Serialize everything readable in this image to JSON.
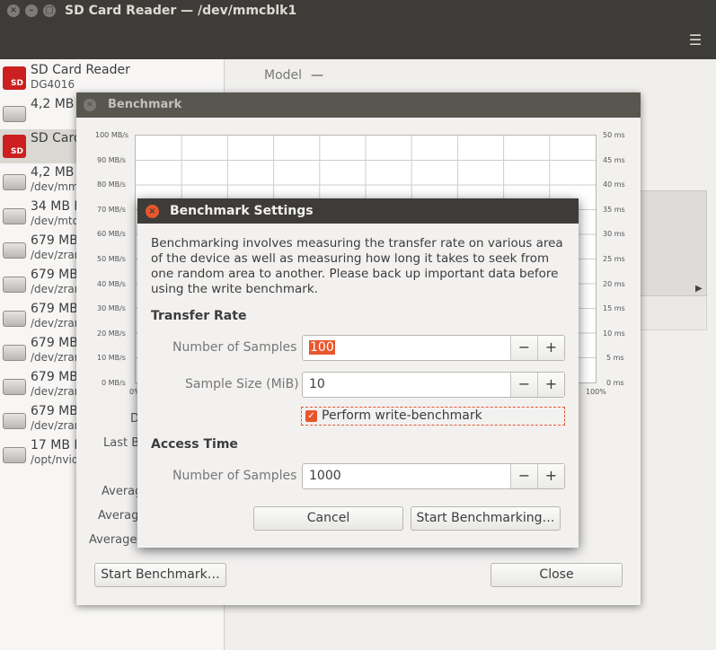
{
  "window": {
    "title": "SD Card Reader — /dev/mmcblk1",
    "menu_icon": "hamburger-menu-icon"
  },
  "sidebar": {
    "items": [
      {
        "line1": "SD Card Reader",
        "line2": "DG4016",
        "icon": "sd-card-icon"
      },
      {
        "line1": "4,2 MB F",
        "line2": "",
        "icon": "drive-icon"
      },
      {
        "line1": "SD Card",
        "line2": "",
        "icon": "sd-card-icon"
      },
      {
        "line1": "4,2 MB F",
        "line2": "/dev/mm",
        "icon": "drive-icon"
      },
      {
        "line1": "34 MB B",
        "line2": "/dev/mto",
        "icon": "drive-icon"
      },
      {
        "line1": "679 MB",
        "line2": "/dev/zrar",
        "icon": "drive-icon"
      },
      {
        "line1": "679 MB",
        "line2": "/dev/zrar",
        "icon": "drive-icon"
      },
      {
        "line1": "679 MB",
        "line2": "/dev/zrar",
        "icon": "drive-icon"
      },
      {
        "line1": "679 MB",
        "line2": "/dev/zrar",
        "icon": "drive-icon"
      },
      {
        "line1": "679 MB",
        "line2": "/dev/zrar",
        "icon": "drive-icon"
      },
      {
        "line1": "679 MB",
        "line2": "/dev/zrar",
        "icon": "drive-icon"
      },
      {
        "line1": "17 MB L",
        "line2": "/opt/nvid",
        "icon": "drive-icon"
      }
    ]
  },
  "main": {
    "model_label": "Model",
    "model_value": "—"
  },
  "benchmark": {
    "title": "Benchmark",
    "y_left_ticks": [
      "100 MB/s",
      "90 MB/s",
      "80 MB/s",
      "70 MB/s",
      "60 MB/s",
      "50 MB/s",
      "40 MB/s",
      "30 MB/s",
      "20 MB/s",
      "10 MB/s",
      "0 MB/s"
    ],
    "y_right_ticks": [
      "50 ms",
      "45 ms",
      "40 ms",
      "35 ms",
      "30 ms",
      "25 ms",
      "20 ms",
      "15 ms",
      "10 ms",
      "5 ms",
      "0 ms"
    ],
    "x_start": "0%",
    "x_end": "100%",
    "side_labels": [
      "D",
      "Last B",
      "Averag",
      "Averag",
      "Average"
    ],
    "start_button": "Start Benchmark…",
    "close_button": "Close"
  },
  "settings": {
    "title": "Benchmark Settings",
    "description": "Benchmarking involves measuring the transfer rate on various area of the device as well as measuring how long it takes to seek from one random area to another. Please back up important data before using the write benchmark.",
    "transfer_rate": {
      "heading": "Transfer Rate",
      "num_samples_label": "Number of Samples",
      "num_samples_value": "100",
      "sample_size_label": "Sample Size (MiB)",
      "sample_size_value": "10",
      "write_benchmark_label": "Perform write-benchmark",
      "write_benchmark_checked": true
    },
    "access_time": {
      "heading": "Access Time",
      "num_samples_label": "Number of Samples",
      "num_samples_value": "1000"
    },
    "cancel_button": "Cancel",
    "start_button": "Start Benchmarking…",
    "minus": "−",
    "plus": "+",
    "accent_color": "#e9562d"
  }
}
